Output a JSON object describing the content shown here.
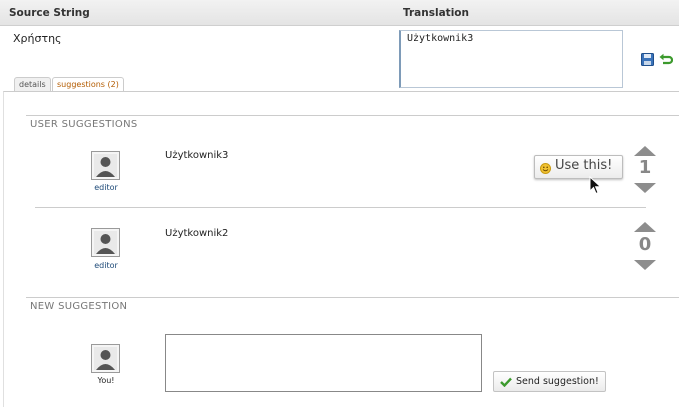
{
  "header": {
    "source_label": "Source String",
    "translation_label": "Translation"
  },
  "unit": {
    "source_text": "Χρήστης",
    "translation_value": "Użytkownik3"
  },
  "icons": {
    "save": "save-icon",
    "revert": "revert-icon"
  },
  "tabs": [
    {
      "label": "details",
      "active": false
    },
    {
      "label": "suggestions (2)",
      "active": true
    }
  ],
  "user_suggestions": {
    "title": "USER SUGGESTIONS",
    "items": [
      {
        "user": "editor",
        "text": "Użytkownik3",
        "score": "1"
      },
      {
        "user": "editor",
        "text": "Użytkownik2",
        "score": "0"
      }
    ],
    "use_this_label": "Use this!"
  },
  "new_suggestion": {
    "title": "NEW SUGGESTION",
    "user": "You!",
    "textarea_value": "",
    "send_label": "Send suggestion!"
  },
  "colors": {
    "accent": "#b35b00",
    "user_link": "#1e4a78",
    "vote_arrow": "#8d8d8d"
  }
}
